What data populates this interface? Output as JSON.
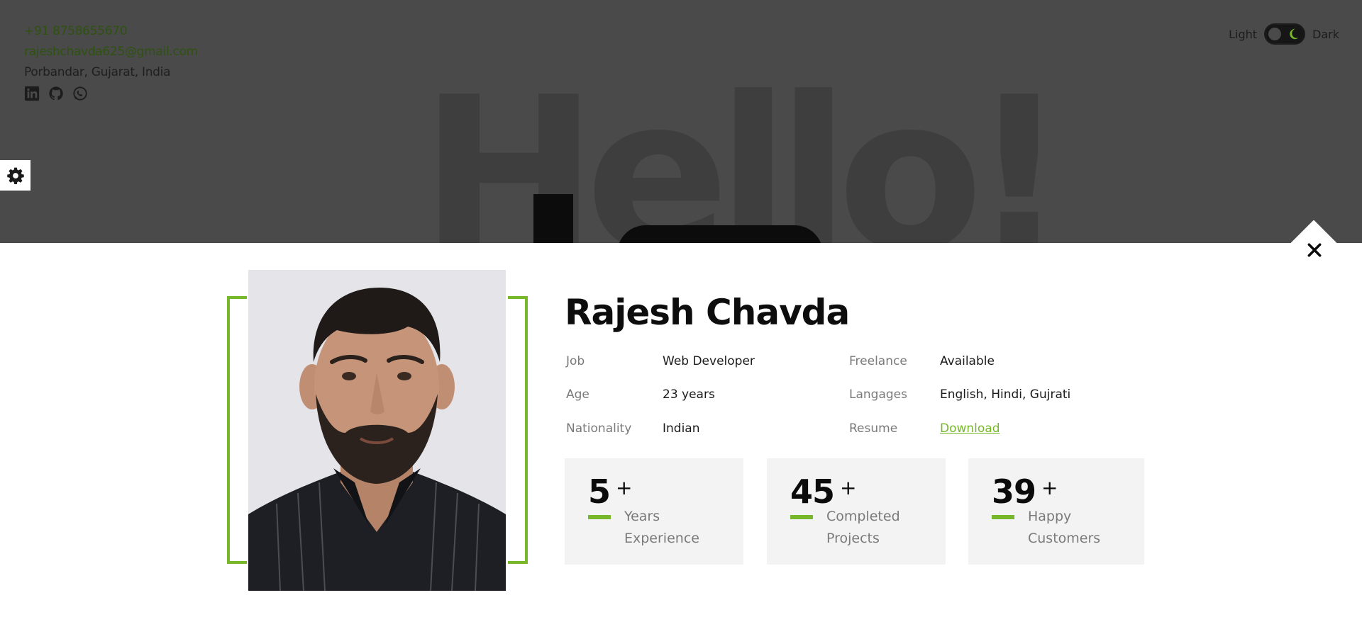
{
  "contact": {
    "phone": "+91 8758655670",
    "email": "rajeshchavda625@gmail.com",
    "location": "Porbandar, Gujarat, India"
  },
  "socials": [
    "linkedin-icon",
    "github-icon",
    "whatsapp-icon"
  ],
  "theme": {
    "light_label": "Light",
    "dark_label": "Dark"
  },
  "hero": {
    "greeting": "Hello!"
  },
  "profile": {
    "name": "Rajesh Chavda",
    "left_info": [
      {
        "key": "Job",
        "value": "Web Developer"
      },
      {
        "key": "Age",
        "value": "23 years"
      },
      {
        "key": "Nationality",
        "value": "Indian"
      }
    ],
    "right_info": [
      {
        "key": "Freelance",
        "value": "Available"
      },
      {
        "key": "Langages",
        "value": "English, Hindi, Gujrati"
      },
      {
        "key": "Resume",
        "value": "Download"
      }
    ]
  },
  "stats": [
    {
      "number": "5",
      "plus": "+",
      "label_line1": "Years",
      "label_line2": "Experience"
    },
    {
      "number": "45",
      "plus": "+",
      "label_line1": "Completed",
      "label_line2": "Projects"
    },
    {
      "number": "39",
      "plus": "+",
      "label_line1": "Happy",
      "label_line2": "Customers"
    }
  ],
  "colors": {
    "accent": "#77b82a",
    "overlay": "#4a4a4a",
    "stat_bg": "#f3f3f3"
  }
}
